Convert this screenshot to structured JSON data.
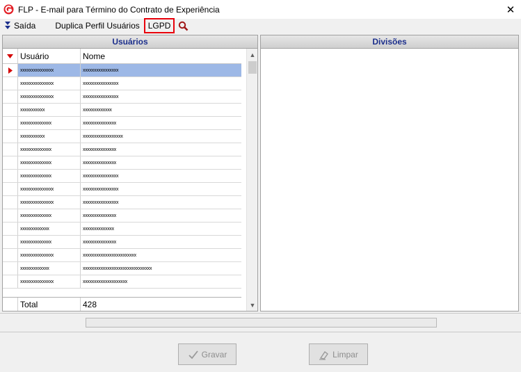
{
  "window": {
    "title": "FLP - E-mail para Término do Contrato de Experiência",
    "close_glyph": "✕",
    "logo_icon": "app-logo-icon"
  },
  "menu": {
    "exit_label": "Saída",
    "duplicate_label": "Duplica Perfil Usuários",
    "lgpd_label": "LGPD",
    "search_icon": "magnifier-icon",
    "lgpd_highlight_color": "#e8000b"
  },
  "users_panel": {
    "title": "Usuários",
    "columns": [
      "Usuário",
      "Nome"
    ],
    "rows": [
      {
        "user": "xxxxxxxxxxxxxxx",
        "name": "xxxxxxxxxxxxxxxx"
      },
      {
        "user": "xxxxxxxxxxxxxxx",
        "name": "xxxxxxxxxxxxxxxx"
      },
      {
        "user": "xxxxxxxxxxxxxxx",
        "name": "xxxxxxxxxxxxxxxx"
      },
      {
        "user": "xxxxxxxxxxx",
        "name": "xxxxxxxxxxxxx"
      },
      {
        "user": "xxxxxxxxxxxxxx",
        "name": "xxxxxxxxxxxxxxx"
      },
      {
        "user": "xxxxxxxxxxx",
        "name": "xxxxxxxxxxxxxxxxxx"
      },
      {
        "user": "xxxxxxxxxxxxxx",
        "name": "xxxxxxxxxxxxxxx"
      },
      {
        "user": "xxxxxxxxxxxxxx",
        "name": "xxxxxxxxxxxxxxx"
      },
      {
        "user": "xxxxxxxxxxxxxx",
        "name": "xxxxxxxxxxxxxxxx"
      },
      {
        "user": "xxxxxxxxxxxxxxx",
        "name": "xxxxxxxxxxxxxxxx"
      },
      {
        "user": "xxxxxxxxxxxxxxx",
        "name": "xxxxxxxxxxxxxxxx"
      },
      {
        "user": "xxxxxxxxxxxxxx",
        "name": "xxxxxxxxxxxxxxx"
      },
      {
        "user": "xxxxxxxxxxxxx",
        "name": "xxxxxxxxxxxxxx"
      },
      {
        "user": "xxxxxxxxxxxxxx",
        "name": "xxxxxxxxxxxxxxx"
      },
      {
        "user": "xxxxxxxxxxxxxxx",
        "name": "xxxxxxxxxxxxxxxxxxxxxxxx"
      },
      {
        "user": "xxxxxxxxxxxxx",
        "name": "xxxxxxxxxxxxxxxxxxxxxxxxxxxxxxx"
      },
      {
        "user": "xxxxxxxxxxxxxxx",
        "name": "xxxxxxxxxxxxxxxxxxxx"
      }
    ],
    "total_label": "Total",
    "total_value": "428",
    "selected_row_color": "#9db8e6"
  },
  "divisions_panel": {
    "title": "Divisões"
  },
  "buttons": {
    "save_label": "Gravar",
    "clear_label": "Limpar"
  }
}
